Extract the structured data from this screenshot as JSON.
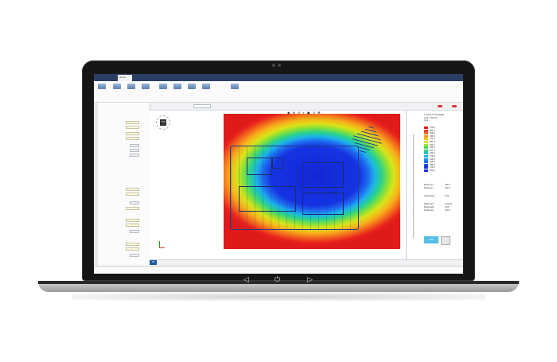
{
  "app": {
    "tabs": [
      "",
      "Home",
      "",
      "",
      "",
      "",
      ""
    ],
    "ribbon_buttons": [
      "",
      "",
      "",
      "",
      "",
      "",
      "",
      "",
      ""
    ]
  },
  "toolbar": {
    "zoom_box": "",
    "items": [
      "",
      "",
      "",
      "",
      "",
      "",
      "",
      ""
    ]
  },
  "left_panel": {
    "sections": [
      "",
      "",
      "",
      "",
      ""
    ],
    "rows": [
      "",
      "",
      "",
      "",
      "",
      "",
      "",
      "",
      "",
      "",
      "",
      "",
      "",
      "",
      "",
      "",
      "",
      "",
      "",
      ""
    ]
  },
  "legend": {
    "title_lines": [
      "TOUCH VOLTAGE",
      "Unit: VOLTS",
      "Unit"
    ],
    "entries": [
      {
        "value": "705.0",
        "color": "#de1a1a"
      },
      {
        "value": "681.0",
        "color": "#ec3a1b"
      },
      {
        "value": "658.0",
        "color": "#f2691c"
      },
      {
        "value": "634.0",
        "color": "#f79a1b"
      },
      {
        "value": "611.0",
        "color": "#f5c219"
      },
      {
        "value": "587.0",
        "color": "#d8e418"
      },
      {
        "value": "564.0",
        "color": "#9be02f"
      },
      {
        "value": "540.0",
        "color": "#55d85a"
      },
      {
        "value": "517.0",
        "color": "#28d28f"
      },
      {
        "value": "493.0",
        "color": "#1dc2c9"
      },
      {
        "value": "470.0",
        "color": "#1db3ea"
      },
      {
        "value": "446.0",
        "color": "#1e8cf0"
      },
      {
        "value": "423.0",
        "color": "#1e6cf0"
      },
      {
        "value": "399.0",
        "color": "#1a4ce8"
      },
      {
        "value": "376.0",
        "color": "#1433e4"
      },
      {
        "value": "352.0",
        "color": "#1326d6"
      }
    ],
    "stats": [
      {
        "label": "Maximum",
        "value": "705.0"
      },
      {
        "label": "Minimum",
        "value": "352.0"
      },
      {
        "label": "Calculated",
        "value": "0.00"
      },
      {
        "label": "Reference",
        "value": "Ground"
      },
      {
        "label": "Magnitude",
        "value": "0.00"
      },
      {
        "label": "Protected",
        "value": "120.0"
      }
    ],
    "button_label": "0.24"
  },
  "status": {
    "badge": "CS",
    "messages": [
      "",
      ""
    ]
  },
  "viewport": {
    "cube_label": "TOP",
    "coord_text": ""
  }
}
